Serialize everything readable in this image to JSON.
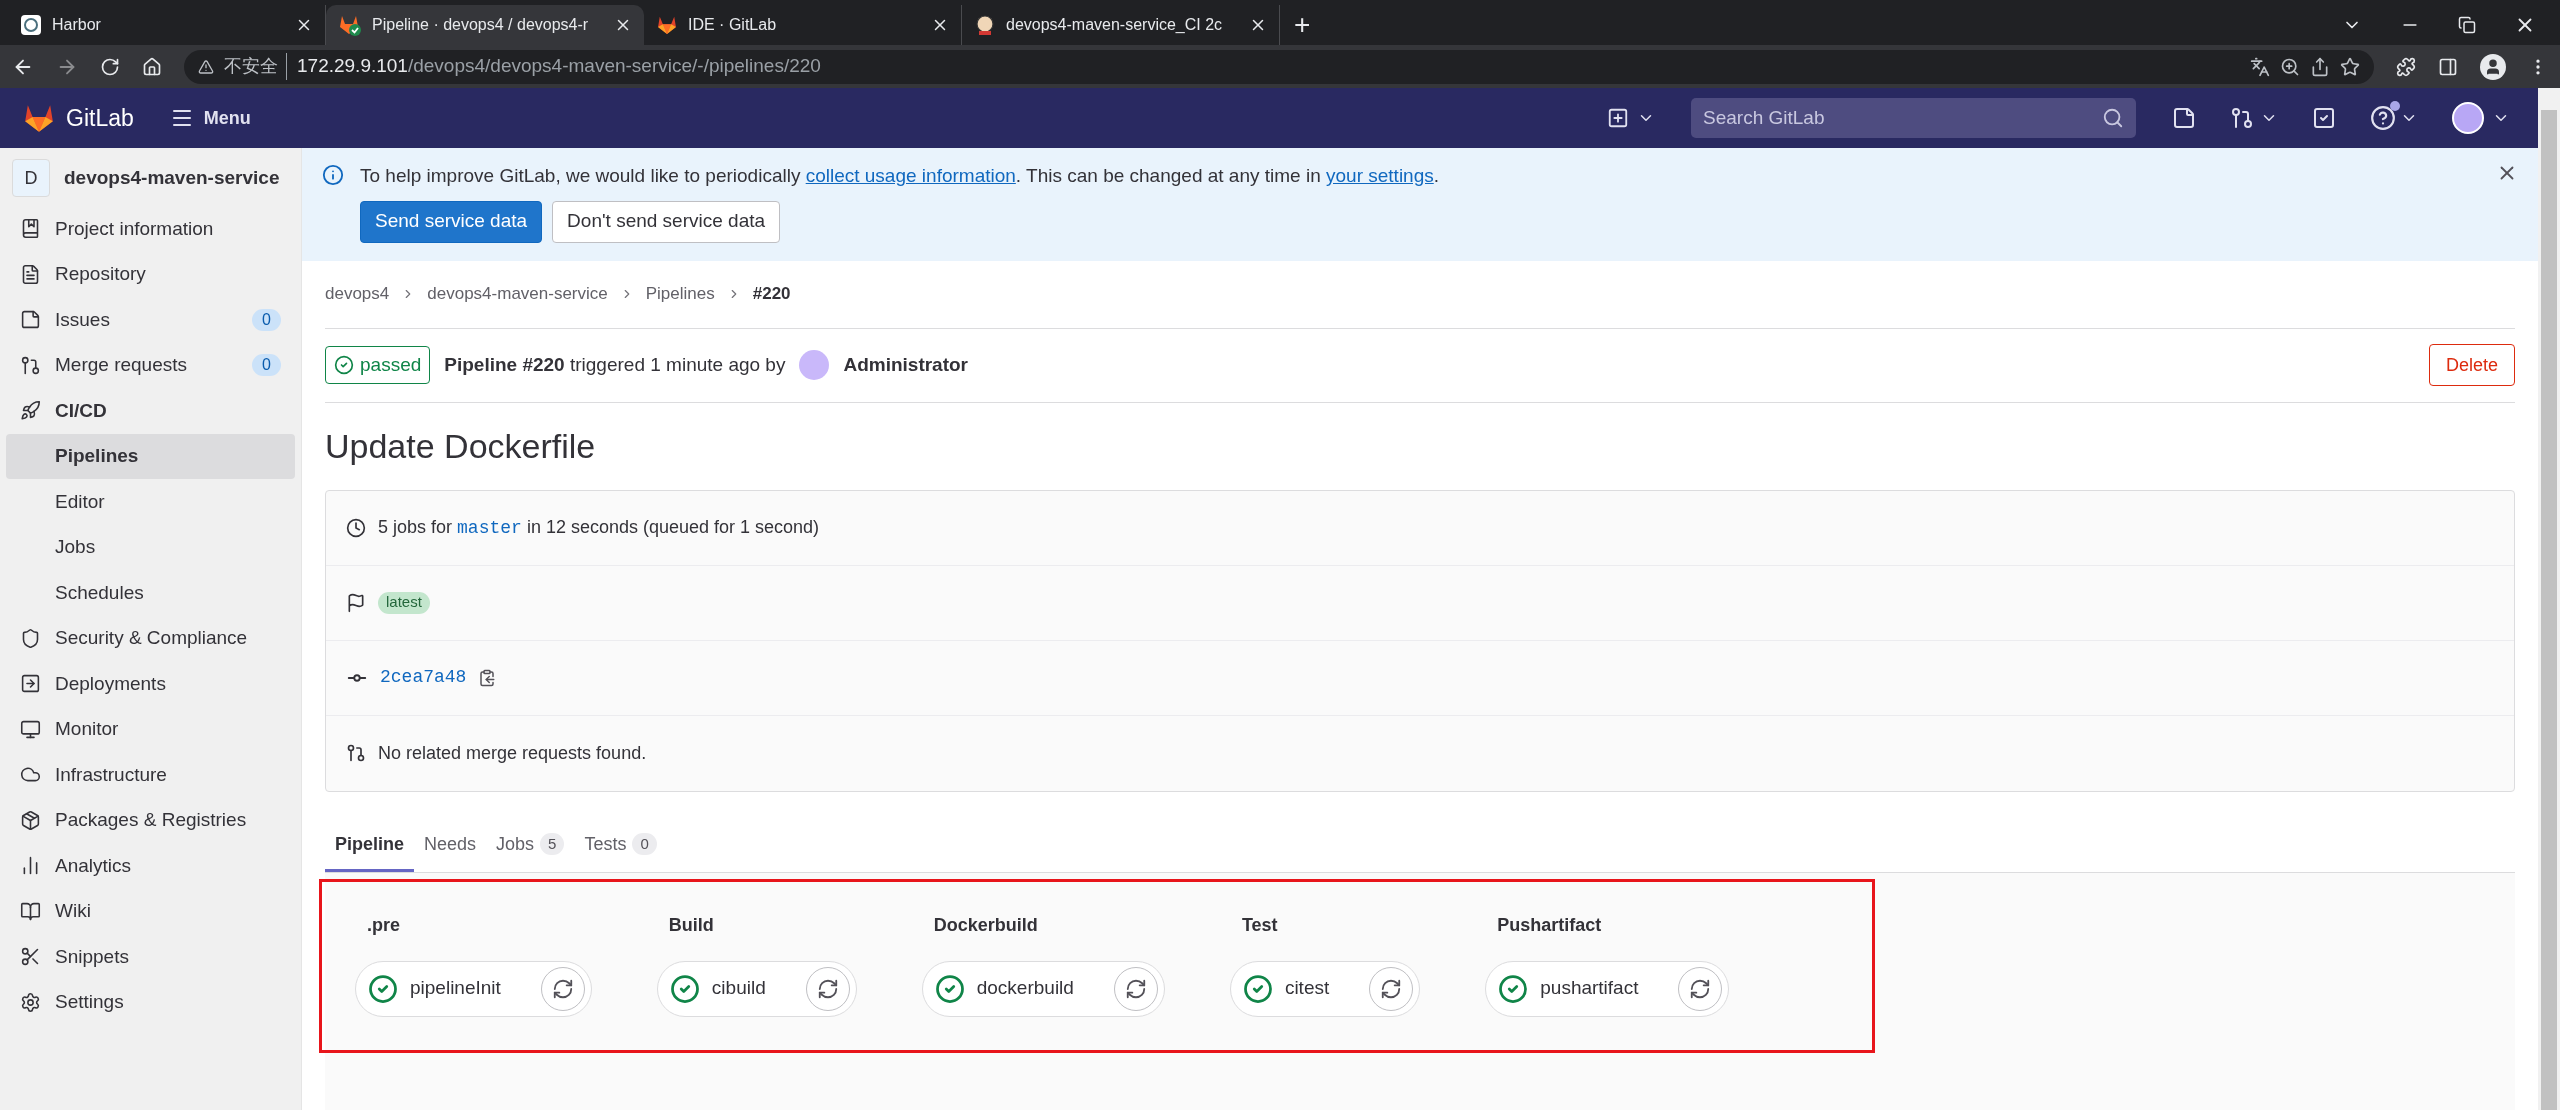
{
  "browser": {
    "tabs": [
      {
        "title": "Harbor",
        "selected": false,
        "kind": "harbor"
      },
      {
        "title": "Pipeline · devops4 / devops4-r",
        "selected": true,
        "kind": "pipeline"
      },
      {
        "title": "IDE · GitLab",
        "selected": false,
        "kind": "gitlab"
      },
      {
        "title": "devops4-maven-service_CI 2c",
        "selected": false,
        "kind": "jenkins"
      }
    ],
    "new_tab": "+",
    "security_label": "不安全",
    "url_host": "172.29.9.101",
    "url_path": "/devops4/devops4-maven-service/-/pipelines/220"
  },
  "header": {
    "brand": "GitLab",
    "menu": "Menu",
    "search": {
      "placeholder": "Search GitLab"
    }
  },
  "sidebar": {
    "project_initial": "D",
    "project_name": "devops4-maven-service",
    "items": [
      {
        "label": "Project information",
        "selected": false
      },
      {
        "label": "Repository",
        "selected": false
      },
      {
        "label": "Issues",
        "count": "0",
        "selected": false
      },
      {
        "label": "Merge requests",
        "count": "0",
        "selected": false
      },
      {
        "label": "CI/CD",
        "selected": false,
        "expanded": true,
        "children": [
          {
            "label": "Pipelines",
            "selected": true
          },
          {
            "label": "Editor",
            "selected": false
          },
          {
            "label": "Jobs",
            "selected": false
          },
          {
            "label": "Schedules",
            "selected": false
          }
        ]
      },
      {
        "label": "Security & Compliance",
        "selected": false
      },
      {
        "label": "Deployments",
        "selected": false
      },
      {
        "label": "Monitor",
        "selected": false
      },
      {
        "label": "Infrastructure",
        "selected": false
      },
      {
        "label": "Packages & Registries",
        "selected": false
      },
      {
        "label": "Analytics",
        "selected": false
      },
      {
        "label": "Wiki",
        "selected": false
      },
      {
        "label": "Snippets",
        "selected": false
      },
      {
        "label": "Settings",
        "selected": false
      }
    ]
  },
  "banner": {
    "message": [
      {
        "kind": "text",
        "text": "To help improve GitLab, we would like to periodically "
      },
      {
        "kind": "link",
        "text": "collect usage information"
      },
      {
        "kind": "text",
        "text": ". This can be changed at any time in "
      },
      {
        "kind": "link",
        "text": "your settings"
      },
      {
        "kind": "text",
        "text": "."
      }
    ],
    "primary_button": "Send service data",
    "secondary_button": "Don't send service data"
  },
  "breadcrumbs": [
    "devops4",
    "devops4-maven-service",
    "Pipelines",
    "#220"
  ],
  "pipeline": {
    "status": "passed",
    "summary": "**Pipeline #220** triggered 1 minute ago by",
    "user": "Administrator",
    "delete_button": "Delete",
    "title": "Update Dockerfile",
    "info": {
      "jobs_before": "5 jobs for",
      "branch": "master",
      "jobs_after": "in 12 seconds (queued for 1 second)",
      "badge": "latest",
      "commit": "2cea7a48",
      "merge_requests": "No related merge requests found."
    }
  },
  "tabs": [
    {
      "label": "Pipeline",
      "selected": true
    },
    {
      "label": "Needs",
      "selected": false
    },
    {
      "label": "Jobs",
      "count": "5",
      "selected": false
    },
    {
      "label": "Tests",
      "count": "0",
      "selected": false
    }
  ],
  "stages": [
    {
      "name": ".pre",
      "jobs": [
        {
          "name": "pipelineInit",
          "passed": true
        }
      ]
    },
    {
      "name": "Build",
      "jobs": [
        {
          "name": "cibuild",
          "passed": true
        }
      ]
    },
    {
      "name": "Dockerbuild",
      "jobs": [
        {
          "name": "dockerbuild",
          "passed": true
        }
      ]
    },
    {
      "name": "Test",
      "jobs": [
        {
          "name": "citest",
          "passed": true
        }
      ]
    },
    {
      "name": "Pushartifact",
      "jobs": [
        {
          "name": "pushartifact",
          "passed": true
        }
      ]
    }
  ]
}
